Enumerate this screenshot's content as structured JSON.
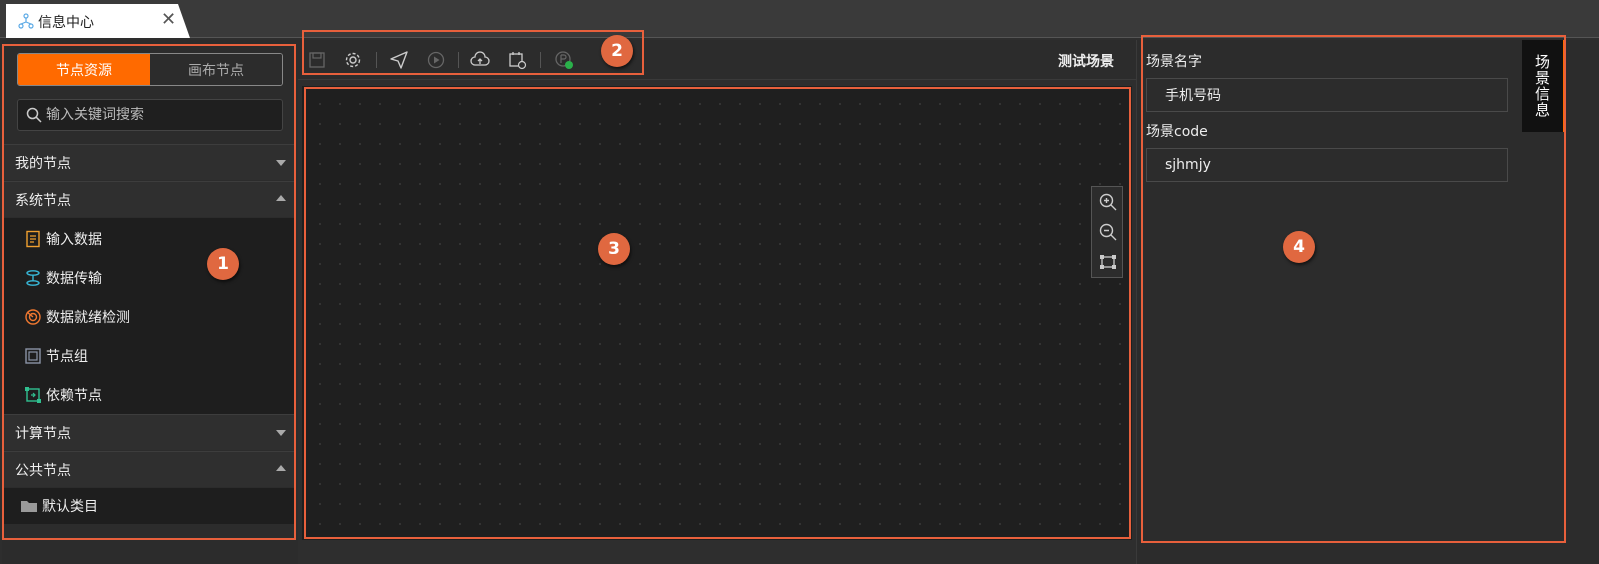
{
  "tab": {
    "title": "信息中心",
    "close": "✕"
  },
  "left": {
    "segment": {
      "active": "节点资源",
      "inactive": "画布节点"
    },
    "search_placeholder": "输入关键词搜索",
    "groups": {
      "mine": "我的节点",
      "system": "系统节点",
      "compute": "计算节点",
      "public": "公共节点"
    },
    "system_items": [
      "输入数据",
      "数据传输",
      "数据就绪检测",
      "节点组",
      "依赖节点"
    ],
    "public_items": [
      "默认类目"
    ]
  },
  "toolbar": {
    "scene_title": "测试场景"
  },
  "right": {
    "side_tab": "场景信息",
    "name_label": "场景名字",
    "name_value": "手机号码",
    "code_label": "场景code",
    "code_value": "sjhmjy"
  },
  "annotations": [
    "1",
    "2",
    "3",
    "4"
  ],
  "colors": {
    "accent": "#ff6a00",
    "annotation": "#e8603c"
  }
}
